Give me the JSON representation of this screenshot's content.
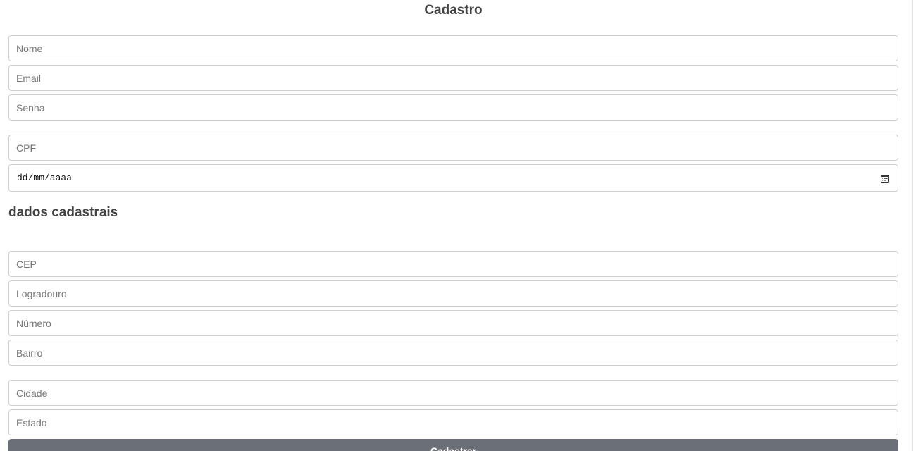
{
  "form": {
    "title": "Cadastro",
    "fields": {
      "nome": {
        "placeholder": "Nome"
      },
      "email": {
        "placeholder": "Email"
      },
      "senha": {
        "placeholder": "Senha"
      },
      "cpf": {
        "placeholder": "CPF"
      },
      "data_nascimento": {
        "value": "dd/mm/aaaa",
        "icon": "calendar-icon"
      }
    }
  },
  "address": {
    "title": "dados cadastrais",
    "fields": {
      "cep": {
        "placeholder": "CEP"
      },
      "logradouro": {
        "placeholder": "Logradouro"
      },
      "numero": {
        "placeholder": "Número"
      },
      "bairro": {
        "placeholder": "Bairro"
      },
      "cidade": {
        "placeholder": "Cidade"
      },
      "estado": {
        "placeholder": "Estado"
      }
    }
  },
  "submit": {
    "label": "Cadastrar"
  },
  "colors": {
    "button_bg": "#6b6f78",
    "title_text": "#444444",
    "field_border": "#cfcfcf"
  }
}
